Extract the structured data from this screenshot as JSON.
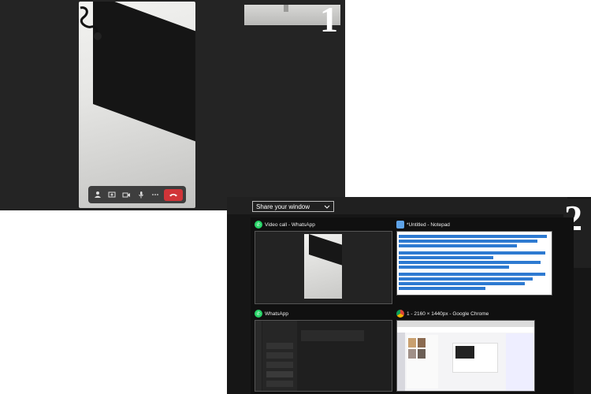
{
  "labels": {
    "step1": "1",
    "step2": "2"
  },
  "call_controls": [
    "people-icon",
    "share-screen-icon",
    "video-icon",
    "mic-icon",
    "more-icon",
    "end-call-icon"
  ],
  "share_panel": {
    "dropdown_label": "Share your window",
    "windows": [
      {
        "title": "Video call - WhatsApp",
        "app_icon": "whatsapp-icon"
      },
      {
        "title": "*Untitled - Notepad",
        "app_icon": "notepad-icon"
      },
      {
        "title": "WhatsApp",
        "app_icon": "whatsapp-icon"
      },
      {
        "title": "1 - 2160 × 1440px - Google Chrome",
        "app_icon": "chrome-icon"
      }
    ]
  },
  "colors": {
    "end_call": "#d13438",
    "whatsapp": "#25d366",
    "selection": "#2e7ad1"
  }
}
